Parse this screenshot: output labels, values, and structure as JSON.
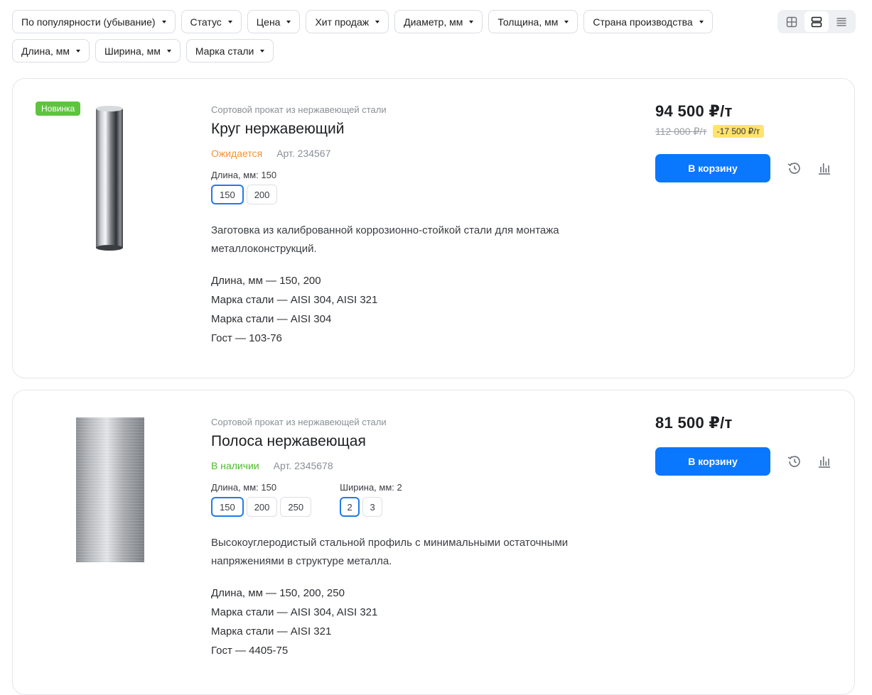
{
  "filters": [
    {
      "label": "По популярности (убывание)"
    },
    {
      "label": "Статус"
    },
    {
      "label": "Цена"
    },
    {
      "label": "Хит продаж"
    },
    {
      "label": "Диаметр, мм"
    },
    {
      "label": "Толщина, мм"
    },
    {
      "label": "Страна производства"
    },
    {
      "label": "Длина, мм"
    },
    {
      "label": "Ширина, мм"
    },
    {
      "label": "Марка стали"
    }
  ],
  "view_modes": [
    "grid-view-icon",
    "list-view-icon",
    "compact-list-icon"
  ],
  "products": [
    {
      "badge": "Новинка",
      "category": "Сортовой прокат из нержавеющей стали",
      "title": "Круг нержавеющий",
      "status": "Ожидается",
      "article": "Арт. 234567",
      "option_groups": [
        {
          "label": "Длина, мм: 150",
          "options": [
            "150",
            "200"
          ],
          "selected": "150"
        }
      ],
      "description": "Заготовка из калиброванной коррозионно-стойкой стали для монтажа металлоконструкций.",
      "specs": [
        "Длина, мм — 150, 200",
        "Марка стали — AISI 304, AISI 321",
        "Марка стали — AISI 304",
        "Гост — 103-76"
      ],
      "price": "94 500 ₽/т",
      "old_price": "112 000 ₽/т",
      "discount": "-17 500 ₽/т",
      "buy_label": "В корзину"
    },
    {
      "category": "Сортовой прокат из нержавеющей стали",
      "title": "Полоса нержавеющая",
      "status": "В наличии",
      "article": "Арт. 2345678",
      "option_groups": [
        {
          "label": "Длина, мм: 150",
          "options": [
            "150",
            "200",
            "250"
          ],
          "selected": "150"
        },
        {
          "label": "Ширина, мм: 2",
          "options": [
            "2",
            "3"
          ],
          "selected": "2"
        }
      ],
      "description": "Высокоуглеродистый стальной профиль с минимальными остаточными напряжениями в структуре металла.",
      "specs": [
        "Длина, мм — 150, 200, 250",
        "Марка стали — AISI 304, AISI 321",
        "Марка стали — AISI 321",
        "Гост — 4405-75"
      ],
      "price": "81 500 ₽/т",
      "buy_label": "В корзину"
    }
  ],
  "colors": {
    "accent": "#0a77ff",
    "new_badge": "#5ec43f",
    "status_wait": "#f29336",
    "status_ok": "#4dbb2b",
    "discount_bg": "#ffe36b"
  }
}
